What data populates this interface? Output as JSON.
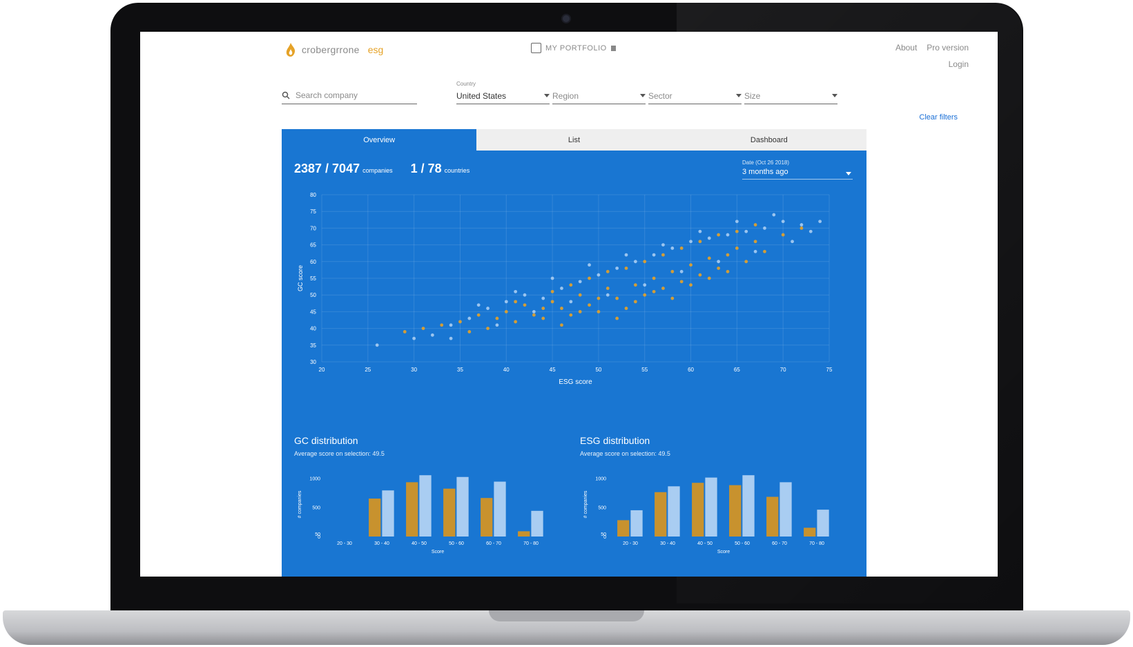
{
  "header": {
    "logo_text": "crobergrrone",
    "logo_accent": "esg"
  },
  "portfolio": {
    "label": "MY PORTFOLIO"
  },
  "nav": {
    "about": "About",
    "pro": "Pro version",
    "login": "Login"
  },
  "search": {
    "placeholder": "Search company"
  },
  "filters": {
    "country_label": "Country",
    "country_value": "United States",
    "region_placeholder": "Region",
    "sector_placeholder": "Sector",
    "size_placeholder": "Size"
  },
  "clear_filters": "Clear filters",
  "tabs": [
    "Overview",
    "List",
    "Dashboard"
  ],
  "stats": {
    "companies": "2387 / 7047",
    "companies_label": "companies",
    "countries": "1 / 78",
    "countries_label": "countries"
  },
  "date": {
    "label": "Date (Oct 26 2018)",
    "value": "3 months ago"
  },
  "colors": {
    "panel": "#1976d2",
    "orange": "#e5a227",
    "light": "#a9cdf2"
  },
  "icons": {
    "search": "search-icon",
    "logo": "flame-logo-icon",
    "portfolio_lock": "lock-icon"
  },
  "chart_data": [
    {
      "type": "scatter",
      "title": "",
      "xlabel": "ESG score",
      "ylabel": "GC score",
      "xlim": [
        20,
        75
      ],
      "ylim": [
        30,
        80
      ],
      "xticks": [
        20,
        25,
        30,
        35,
        40,
        45,
        50,
        55,
        60,
        65,
        70,
        75
      ],
      "yticks": [
        30,
        35,
        40,
        45,
        50,
        55,
        60,
        65,
        70,
        75,
        80
      ],
      "grid": true,
      "series": [
        {
          "color": "#e5a227",
          "points": [
            [
              29,
              39
            ],
            [
              31,
              40
            ],
            [
              33,
              41
            ],
            [
              35,
              42
            ],
            [
              37,
              44
            ],
            [
              38,
              40
            ],
            [
              40,
              45
            ],
            [
              41,
              42
            ],
            [
              42,
              47
            ],
            [
              43,
              44
            ],
            [
              44,
              43
            ],
            [
              45,
              48
            ],
            [
              46,
              46
            ],
            [
              47,
              44
            ],
            [
              48,
              50
            ],
            [
              49,
              47
            ],
            [
              50,
              45
            ],
            [
              51,
              52
            ],
            [
              52,
              49
            ],
            [
              53,
              46
            ],
            [
              54,
              53
            ],
            [
              55,
              50
            ],
            [
              56,
              55
            ],
            [
              57,
              52
            ],
            [
              58,
              57
            ],
            [
              59,
              54
            ],
            [
              60,
              59
            ],
            [
              61,
              56
            ],
            [
              62,
              61
            ],
            [
              63,
              58
            ],
            [
              64,
              62
            ],
            [
              65,
              64
            ],
            [
              66,
              60
            ],
            [
              67,
              66
            ],
            [
              68,
              63
            ],
            [
              70,
              68
            ],
            [
              72,
              70
            ],
            [
              36,
              39
            ],
            [
              39,
              43
            ],
            [
              41,
              48
            ],
            [
              44,
              46
            ],
            [
              46,
              41
            ],
            [
              48,
              45
            ],
            [
              50,
              49
            ],
            [
              52,
              43
            ],
            [
              54,
              48
            ],
            [
              56,
              51
            ],
            [
              58,
              49
            ],
            [
              60,
              53
            ],
            [
              62,
              55
            ],
            [
              64,
              57
            ],
            [
              45,
              51
            ],
            [
              47,
              53
            ],
            [
              49,
              55
            ],
            [
              51,
              57
            ],
            [
              53,
              58
            ],
            [
              55,
              60
            ],
            [
              57,
              62
            ],
            [
              59,
              64
            ],
            [
              61,
              66
            ],
            [
              63,
              68
            ],
            [
              65,
              69
            ],
            [
              67,
              71
            ]
          ]
        },
        {
          "color": "#a9cdf2",
          "points": [
            [
              32,
              38
            ],
            [
              34,
              41
            ],
            [
              36,
              43
            ],
            [
              38,
              46
            ],
            [
              40,
              48
            ],
            [
              42,
              50
            ],
            [
              44,
              49
            ],
            [
              46,
              52
            ],
            [
              48,
              54
            ],
            [
              50,
              56
            ],
            [
              52,
              58
            ],
            [
              54,
              60
            ],
            [
              56,
              62
            ],
            [
              58,
              64
            ],
            [
              60,
              66
            ],
            [
              62,
              67
            ],
            [
              64,
              68
            ],
            [
              66,
              69
            ],
            [
              68,
              70
            ],
            [
              70,
              72
            ],
            [
              72,
              71
            ],
            [
              73,
              69
            ],
            [
              34,
              37
            ],
            [
              39,
              41
            ],
            [
              43,
              45
            ],
            [
              47,
              48
            ],
            [
              51,
              50
            ],
            [
              55,
              53
            ],
            [
              59,
              57
            ],
            [
              63,
              60
            ],
            [
              67,
              63
            ],
            [
              71,
              66
            ],
            [
              26,
              35
            ],
            [
              30,
              37
            ],
            [
              37,
              47
            ],
            [
              41,
              51
            ],
            [
              45,
              55
            ],
            [
              49,
              59
            ],
            [
              53,
              62
            ],
            [
              57,
              65
            ],
            [
              61,
              69
            ],
            [
              65,
              72
            ],
            [
              69,
              74
            ],
            [
              74,
              72
            ]
          ]
        }
      ]
    },
    {
      "type": "bar",
      "title": "GC distribution",
      "subtitle": "Average score on selection: 49.5",
      "xlabel": "Score",
      "ylabel": "# companies",
      "categories": [
        "20 - 30",
        "30 - 40",
        "40 - 50",
        "50 - 60",
        "60 - 70",
        "70 - 80"
      ],
      "yticks": [
        0,
        50,
        500,
        1000
      ],
      "series": [
        {
          "color": "#c8922e",
          "values": [
            0,
            650,
            930,
            820,
            660,
            90
          ]
        },
        {
          "color": "#a9cdf2",
          "values": [
            0,
            790,
            1050,
            1020,
            940,
            440
          ]
        }
      ]
    },
    {
      "type": "bar",
      "title": "ESG distribution",
      "subtitle": "Average score on selection: 49.5",
      "xlabel": "Score",
      "ylabel": "# companies",
      "categories": [
        "20 - 30",
        "30 - 40",
        "40 - 50",
        "50 - 60",
        "60 - 70",
        "70 - 80"
      ],
      "yticks": [
        0,
        50,
        500,
        1000
      ],
      "series": [
        {
          "color": "#c8922e",
          "values": [
            280,
            760,
            920,
            880,
            680,
            150
          ]
        },
        {
          "color": "#a9cdf2",
          "values": [
            450,
            860,
            1010,
            1050,
            930,
            460
          ]
        }
      ]
    }
  ]
}
